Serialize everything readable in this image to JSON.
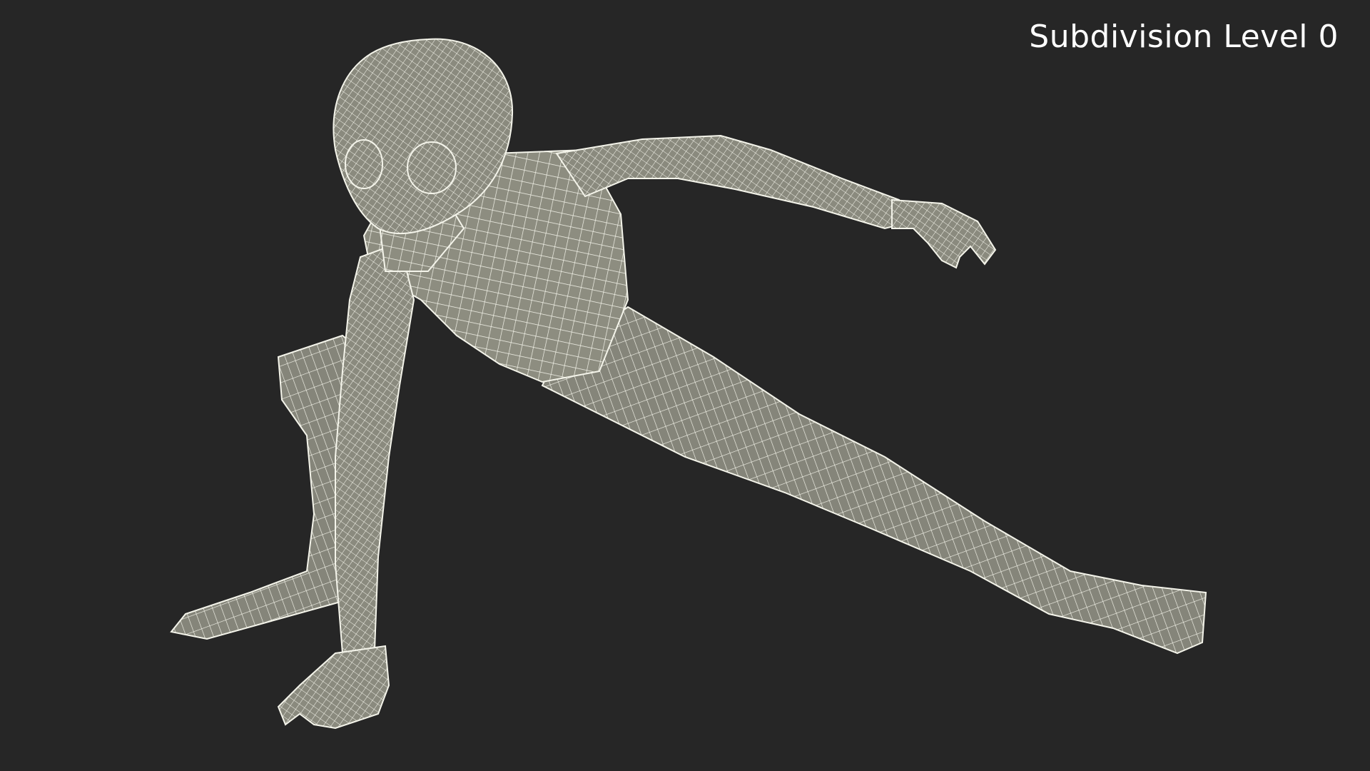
{
  "overlay": {
    "subdivision_label": "Subdivision Level 0"
  },
  "colors": {
    "background": "#262626",
    "mesh_fill": "#8d8d80",
    "mesh_shade": "#6f6f64",
    "wire": "#f4f4ea"
  }
}
